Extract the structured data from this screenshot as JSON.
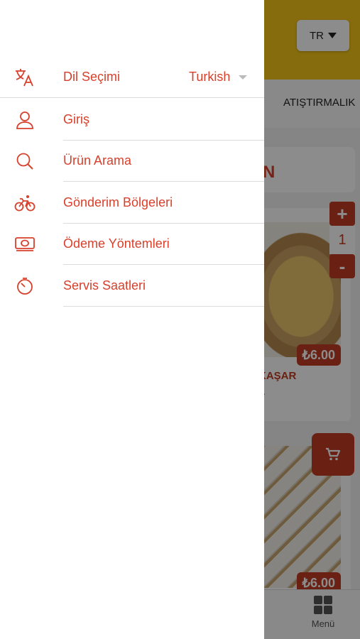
{
  "app": {
    "header_language": "TR",
    "category": "ATIŞTIRMALIK",
    "search_fragment": "N",
    "products": [
      {
        "name": "KAŞAR",
        "desc": "...",
        "price": "₺6.00"
      },
      {
        "price": "₺6.00"
      }
    ],
    "quantity": "1",
    "plus": "+",
    "minus": "-",
    "tab_menu_label": "Menü"
  },
  "drawer": {
    "language": {
      "label": "Dil Seçimi",
      "value": "Turkish",
      "icon": "translate-icon"
    },
    "items": [
      {
        "label": "Giriş",
        "icon": "user-icon"
      },
      {
        "label": "Ürün Arama",
        "icon": "search-icon"
      },
      {
        "label": "Gönderim Bölgeleri",
        "icon": "bicycle-icon"
      },
      {
        "label": "Ödeme Yöntemleri",
        "icon": "money-icon"
      },
      {
        "label": "Servis Saatleri",
        "icon": "timer-icon"
      }
    ]
  },
  "colors": {
    "accent": "#d7402b",
    "header": "#f6c518",
    "button": "#c23b22"
  }
}
